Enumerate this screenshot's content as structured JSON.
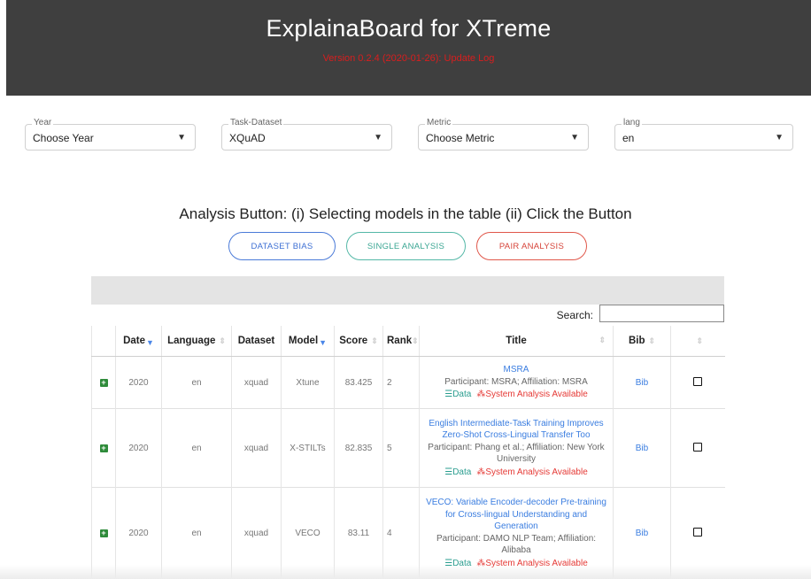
{
  "header": {
    "title": "ExplainaBoard for XTreme",
    "version": "Version 0.2.4 (2020-01-26): Update Log"
  },
  "filters": [
    {
      "label": "Year",
      "value": "Choose Year"
    },
    {
      "label": "Task-Dataset",
      "value": "XQuAD"
    },
    {
      "label": "Metric",
      "value": "Choose Metric"
    },
    {
      "label": "lang",
      "value": "en"
    }
  ],
  "analysis": {
    "title": "Analysis Button: (i) Selecting models in the table (ii) Click the Button",
    "buttons": [
      "DATASET BIAS",
      "SINGLE ANALYSIS",
      "PAIR ANALYSIS"
    ]
  },
  "search": {
    "label": "Search:",
    "value": ""
  },
  "table": {
    "columns": [
      "Date",
      "Language",
      "Dataset",
      "Model",
      "Score",
      "Rank",
      "Title",
      "Bib"
    ],
    "rows": [
      {
        "date": "2020",
        "language": "en",
        "dataset": "xquad",
        "model": "Xtune",
        "score": "83.425",
        "rank": "2",
        "title": "MSRA",
        "meta": "Participant: MSRA; Affiliation: MSRA",
        "data_label": "Data",
        "system_label": "System Analysis Available",
        "bib": "Bib"
      },
      {
        "date": "2020",
        "language": "en",
        "dataset": "xquad",
        "model": "X-STILTs",
        "score": "82.835",
        "rank": "5",
        "title": "English Intermediate-Task Training Improves Zero-Shot Cross-Lingual Transfer Too",
        "meta": "Participant: Phang et al.; Affiliation: New York University",
        "data_label": "Data",
        "system_label": "System Analysis Available",
        "bib": "Bib"
      },
      {
        "date": "2020",
        "language": "en",
        "dataset": "xquad",
        "model": "VECO",
        "score": "83.11",
        "rank": "4",
        "title": "VECO: Variable Encoder-decoder Pre-training for Cross-lingual Understanding and Generation",
        "meta": "Participant: DAMO NLP Team; Affiliation: Alibaba",
        "data_label": "Data",
        "system_label": "System Analysis Available",
        "bib": "Bib"
      }
    ]
  },
  "colors": {
    "header_bg": "#3f3f3f",
    "version_red": "#d81e1e",
    "link_blue": "#3a7de0",
    "data_teal": "#2a9d8f",
    "system_red": "#e53935"
  }
}
